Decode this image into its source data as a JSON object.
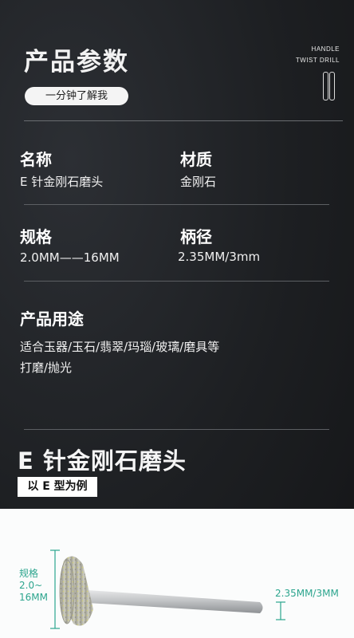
{
  "header": {
    "title": "产品参数",
    "subtitle_pill": "一分钟了解我",
    "brand_line1": "HANDLE",
    "brand_line2": "TWIST DRILL"
  },
  "specs": {
    "name_label": "名称",
    "name_value": "E 针金刚石磨头",
    "material_label": "材质",
    "material_value": "金刚石",
    "size_label": "规格",
    "size_value": "2.0MM——16MM",
    "shank_label": "柄径",
    "shank_value": "2.35MM/3mm",
    "usage_label": "产品用途",
    "usage_line1": "适合玉器/玉石/翡翠/玛瑙/玻璃/磨具等",
    "usage_line2": "打磨/抛光"
  },
  "product": {
    "name": "E 针金刚石磨头",
    "tag": "以 E  型为例"
  },
  "diagram": {
    "size_label_line1": "规格",
    "size_label_line2": "2.0~",
    "size_label_line3": "16MM",
    "shank_label": "2.35MM/3MM",
    "accent_color": "#2ca58e"
  }
}
